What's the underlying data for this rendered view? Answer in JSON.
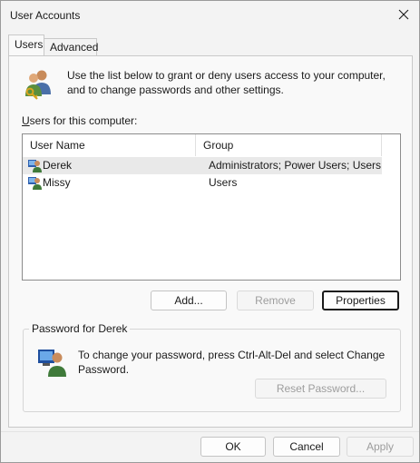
{
  "window": {
    "title": "User Accounts"
  },
  "tabs": [
    {
      "label": "Users",
      "active": true
    },
    {
      "label": "Advanced",
      "active": false
    }
  ],
  "intro": {
    "text": "Use the list below to grant or deny users access to your computer, and to change passwords and other settings."
  },
  "users_list": {
    "label": "Users for this computer:",
    "columns": [
      "User Name",
      "Group"
    ],
    "rows": [
      {
        "name": "Derek",
        "group": "Administrators; Power Users; Users",
        "selected": true
      },
      {
        "name": "Missy",
        "group": "Users",
        "selected": false
      }
    ]
  },
  "list_buttons": {
    "add": "Add...",
    "remove": "Remove",
    "properties": "Properties"
  },
  "password": {
    "group_title": "Password for Derek",
    "text": "To change your password, press Ctrl-Alt-Del and select Change Password.",
    "reset_button": "Reset Password..."
  },
  "footer": {
    "ok": "OK",
    "cancel": "Cancel",
    "apply": "Apply"
  },
  "icons": {
    "window_close": "close-icon",
    "users_header": "users-keys-icon",
    "user_row": "user-icon",
    "password": "user-monitor-icon"
  },
  "colors": {
    "selected_row": "#e9e9e9",
    "disabled_text": "#9d9d9d"
  }
}
